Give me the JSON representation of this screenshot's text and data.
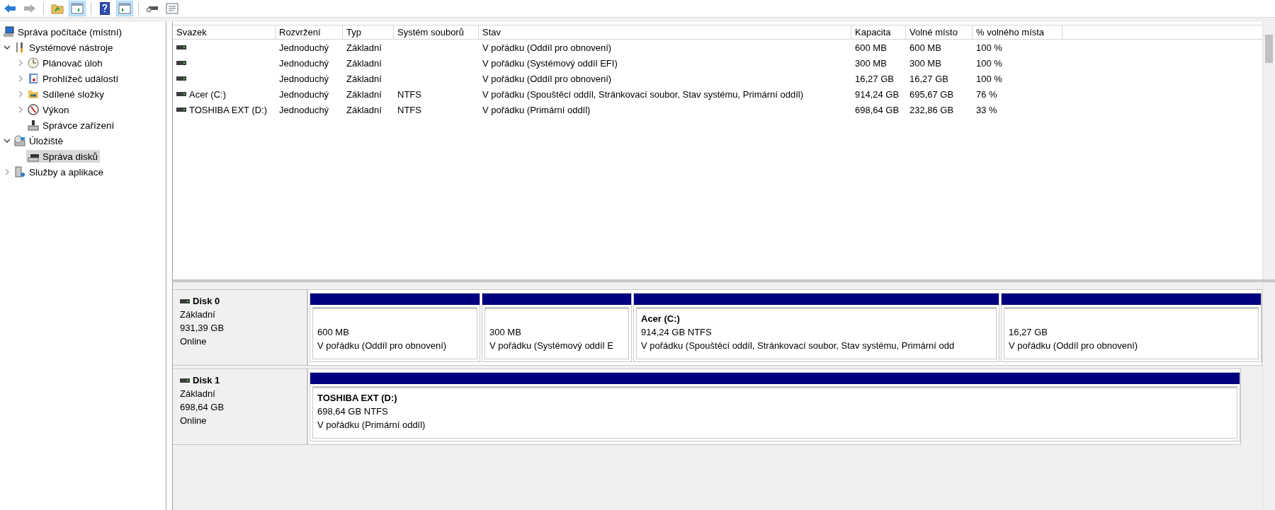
{
  "toolbar": [
    {
      "kind": "back",
      "disabled": false,
      "pressed": false
    },
    {
      "kind": "forward",
      "disabled": true,
      "pressed": false
    },
    {
      "kind": "up",
      "disabled": false,
      "pressed": false
    },
    {
      "kind": "tree-pane",
      "disabled": false,
      "pressed": true
    },
    {
      "kind": "help",
      "disabled": false,
      "pressed": false
    },
    {
      "kind": "action-pane",
      "disabled": false,
      "pressed": true
    },
    {
      "kind": "connect",
      "disabled": false,
      "pressed": false
    },
    {
      "kind": "properties",
      "disabled": false,
      "pressed": false
    }
  ],
  "tree": [
    {
      "label": "Správa počítače (místní)",
      "kind": "root",
      "selected": false,
      "children": [
        {
          "label": "Systémové nástroje",
          "kind": "branch",
          "expanded": true,
          "selected": false,
          "children": [
            {
              "label": "Plánovač úloh",
              "kind": "branch",
              "expanded": false,
              "selected": false
            },
            {
              "label": "Prohlížeč událostí",
              "kind": "branch",
              "expanded": false,
              "selected": false
            },
            {
              "label": "Sdílené složky",
              "kind": "branch",
              "expanded": false,
              "selected": false
            },
            {
              "label": "Výkon",
              "kind": "branch",
              "expanded": false,
              "selected": false
            },
            {
              "label": "Správce zařízení",
              "kind": "leaf",
              "selected": false
            }
          ]
        },
        {
          "label": "Úložiště",
          "kind": "branch",
          "expanded": true,
          "selected": false,
          "children": [
            {
              "label": "Správa disků",
              "kind": "leaf",
              "selected": true
            }
          ]
        },
        {
          "label": "Služby a aplikace",
          "kind": "branch",
          "expanded": false,
          "selected": false
        }
      ]
    }
  ],
  "table": {
    "columns": [
      "Svazek",
      "Rozvržení",
      "Typ",
      "Systém souborů",
      "Stav",
      "Kapacita",
      "Volné místo",
      "% volného místa"
    ],
    "rows": [
      [
        "",
        "Jednoduchý",
        "Základní",
        "",
        "V pořádku (Oddíl pro obnovení)",
        "600 MB",
        "600 MB",
        "100 %"
      ],
      [
        "",
        "Jednoduchý",
        "Základní",
        "",
        "V pořádku (Systémový oddíl EFI)",
        "300 MB",
        "300 MB",
        "100 %"
      ],
      [
        "",
        "Jednoduchý",
        "Základní",
        "",
        "V pořádku (Oddíl pro obnovení)",
        "16,27 GB",
        "16,27 GB",
        "100 %"
      ],
      [
        "Acer (C:)",
        "Jednoduchý",
        "Základní",
        "NTFS",
        "V pořádku (Spouštěcí oddíl, Stránkovací soubor, Stav systému, Primární oddíl)",
        "914,24 GB",
        "695,67 GB",
        "76 %"
      ],
      [
        "TOSHIBA EXT (D:)",
        "Jednoduchý",
        "Základní",
        "NTFS",
        "V pořádku (Primární oddíl)",
        "698,64 GB",
        "232,86 GB",
        "33 %"
      ]
    ]
  },
  "disks": [
    {
      "name": "Disk 0",
      "type": "Základní",
      "size": "931,39 GB",
      "status": "Online",
      "partitions": [
        {
          "size": "600 MB",
          "status": "V pořádku (Oddíl pro obnovení)"
        },
        {
          "size": "300 MB",
          "status": "V pořádku (Systémový oddíl E"
        },
        {
          "title": "Acer  (C:)",
          "size": "914,24 GB NTFS",
          "status": "V pořádku (Spouštěcí oddíl, Stránkovací soubor, Stav systému, Primární odd"
        },
        {
          "size": "16,27 GB",
          "status": "V pořádku (Oddíl pro obnovení)"
        }
      ]
    },
    {
      "name": "Disk 1",
      "type": "Základní",
      "size": "698,64 GB",
      "status": "Online",
      "partitions": [
        {
          "title": "TOSHIBA EXT  (D:)",
          "size": "698,64 GB NTFS",
          "status": "V pořádku (Primární oddíl)"
        }
      ]
    }
  ]
}
